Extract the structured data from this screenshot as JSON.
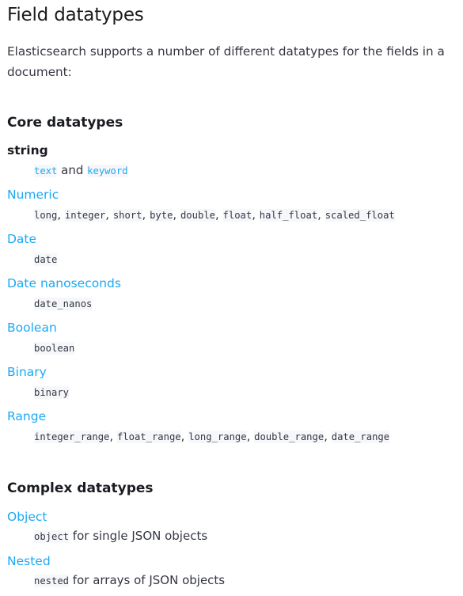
{
  "title": "Field datatypes",
  "intro": "Elasticsearch supports a number of different datatypes for the fields in a document:",
  "core": {
    "heading": "Core datatypes",
    "string": {
      "term": "string",
      "text": "text",
      "and": "and",
      "keyword": "keyword"
    },
    "numeric": {
      "term": "Numeric",
      "types": [
        "long",
        "integer",
        "short",
        "byte",
        "double",
        "float",
        "half_float",
        "scaled_float"
      ]
    },
    "date": {
      "term": "Date",
      "types": [
        "date"
      ]
    },
    "date_nanos": {
      "term": "Date nanoseconds",
      "types": [
        "date_nanos"
      ]
    },
    "boolean": {
      "term": "Boolean",
      "types": [
        "boolean"
      ]
    },
    "binary": {
      "term": "Binary",
      "types": [
        "binary"
      ]
    },
    "range": {
      "term": "Range",
      "types": [
        "integer_range",
        "float_range",
        "long_range",
        "double_range",
        "date_range"
      ]
    }
  },
  "complex": {
    "heading": "Complex datatypes",
    "object": {
      "term": "Object",
      "code": "object",
      "desc": " for single JSON objects"
    },
    "nested": {
      "term": "Nested",
      "code": "nested",
      "desc": " for arrays of JSON objects"
    }
  }
}
